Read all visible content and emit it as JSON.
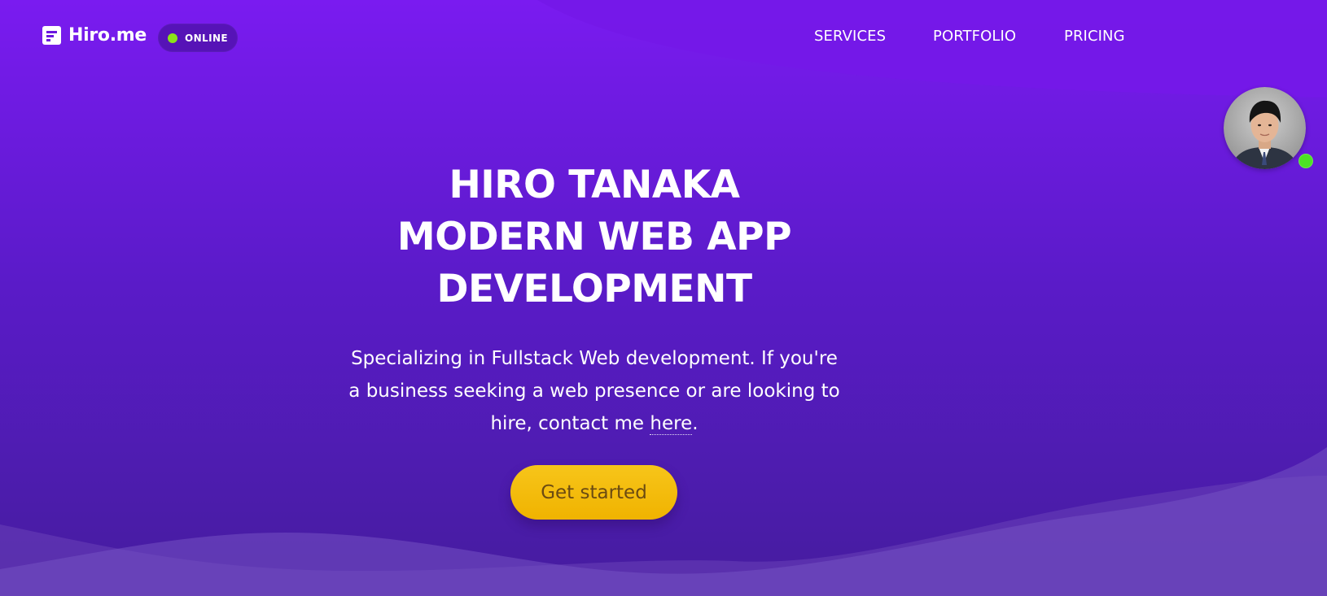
{
  "header": {
    "brand_name": "Hiro.me",
    "brand_icon": "document-lines-icon",
    "status_label": "ONLINE",
    "status_color": "#8be31a"
  },
  "nav": {
    "items": [
      {
        "label": "SERVICES"
      },
      {
        "label": "PORTFOLIO"
      },
      {
        "label": "PRICING"
      }
    ]
  },
  "hero": {
    "title_lines": [
      "HIRO TANAKA",
      "MODERN WEB APP",
      "DEVELOPMENT"
    ],
    "description_before_link": "Specializing in Fullstack Web development. If you're a business seeking a web presence or are looking to hire, contact me ",
    "description_link": "here",
    "description_after_link": ".",
    "cta_label": "Get started"
  },
  "avatar": {
    "online_color": "#4ce324"
  },
  "colors": {
    "gradient_top": "#7a1bf0",
    "gradient_bottom": "#451c9e",
    "cta": "#f5bd00",
    "cta_text": "#6b4b12"
  }
}
